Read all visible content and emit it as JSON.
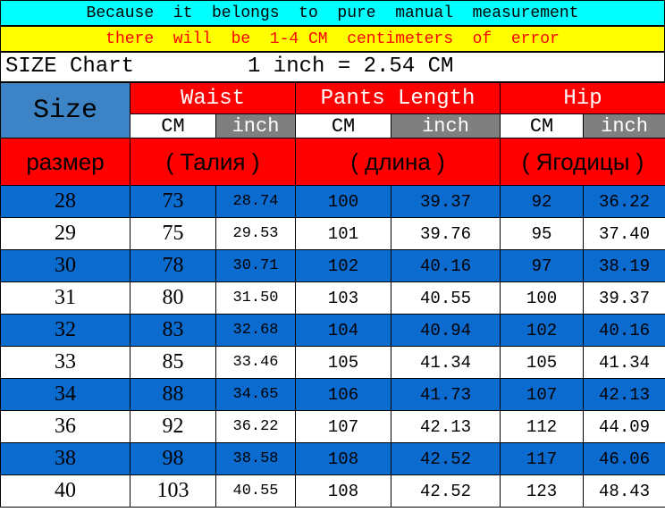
{
  "banner": {
    "line1": "Because  it  belongs  to  pure  manual  measurement",
    "line2": "there  will  be  1-4 CM  centimeters  of  error"
  },
  "title": {
    "left": "SIZE Chart",
    "conversion": "1 inch = 2.54 CM"
  },
  "header": {
    "size": "Size",
    "groups": [
      "Waist",
      "Pants Length",
      "Hip"
    ],
    "unit_cm": "CM",
    "unit_inch": "inch",
    "ru_size": "размер",
    "ru_groups": [
      "( Талия )",
      "( длина )",
      "( Ягодицы )"
    ]
  },
  "rows": [
    {
      "size": "28",
      "waist_cm": "73",
      "waist_in": "28.74",
      "len_cm": "100",
      "len_in": "39.37",
      "hip_cm": "92",
      "hip_in": "36.22"
    },
    {
      "size": "29",
      "waist_cm": "75",
      "waist_in": "29.53",
      "len_cm": "101",
      "len_in": "39.76",
      "hip_cm": "95",
      "hip_in": "37.40"
    },
    {
      "size": "30",
      "waist_cm": "78",
      "waist_in": "30.71",
      "len_cm": "102",
      "len_in": "40.16",
      "hip_cm": "97",
      "hip_in": "38.19"
    },
    {
      "size": "31",
      "waist_cm": "80",
      "waist_in": "31.50",
      "len_cm": "103",
      "len_in": "40.55",
      "hip_cm": "100",
      "hip_in": "39.37"
    },
    {
      "size": "32",
      "waist_cm": "83",
      "waist_in": "32.68",
      "len_cm": "104",
      "len_in": "40.94",
      "hip_cm": "102",
      "hip_in": "40.16"
    },
    {
      "size": "33",
      "waist_cm": "85",
      "waist_in": "33.46",
      "len_cm": "105",
      "len_in": "41.34",
      "hip_cm": "105",
      "hip_in": "41.34"
    },
    {
      "size": "34",
      "waist_cm": "88",
      "waist_in": "34.65",
      "len_cm": "106",
      "len_in": "41.73",
      "hip_cm": "107",
      "hip_in": "42.13"
    },
    {
      "size": "36",
      "waist_cm": "92",
      "waist_in": "36.22",
      "len_cm": "107",
      "len_in": "42.13",
      "hip_cm": "112",
      "hip_in": "44.09"
    },
    {
      "size": "38",
      "waist_cm": "98",
      "waist_in": "38.58",
      "len_cm": "108",
      "len_in": "42.52",
      "hip_cm": "117",
      "hip_in": "46.06"
    },
    {
      "size": "40",
      "waist_cm": "103",
      "waist_in": "40.55",
      "len_cm": "108",
      "len_in": "42.52",
      "hip_cm": "123",
      "hip_in": "48.43"
    }
  ],
  "colors": {
    "banner1": "#00ffff",
    "banner2": "#ffff00",
    "error_text": "#ff0000",
    "size_header": "#3d84c6",
    "group_header": "#ff0000",
    "inch_header": "#7f7f7f",
    "row_blue": "#0b6bcf",
    "row_white": "#ffffff"
  }
}
